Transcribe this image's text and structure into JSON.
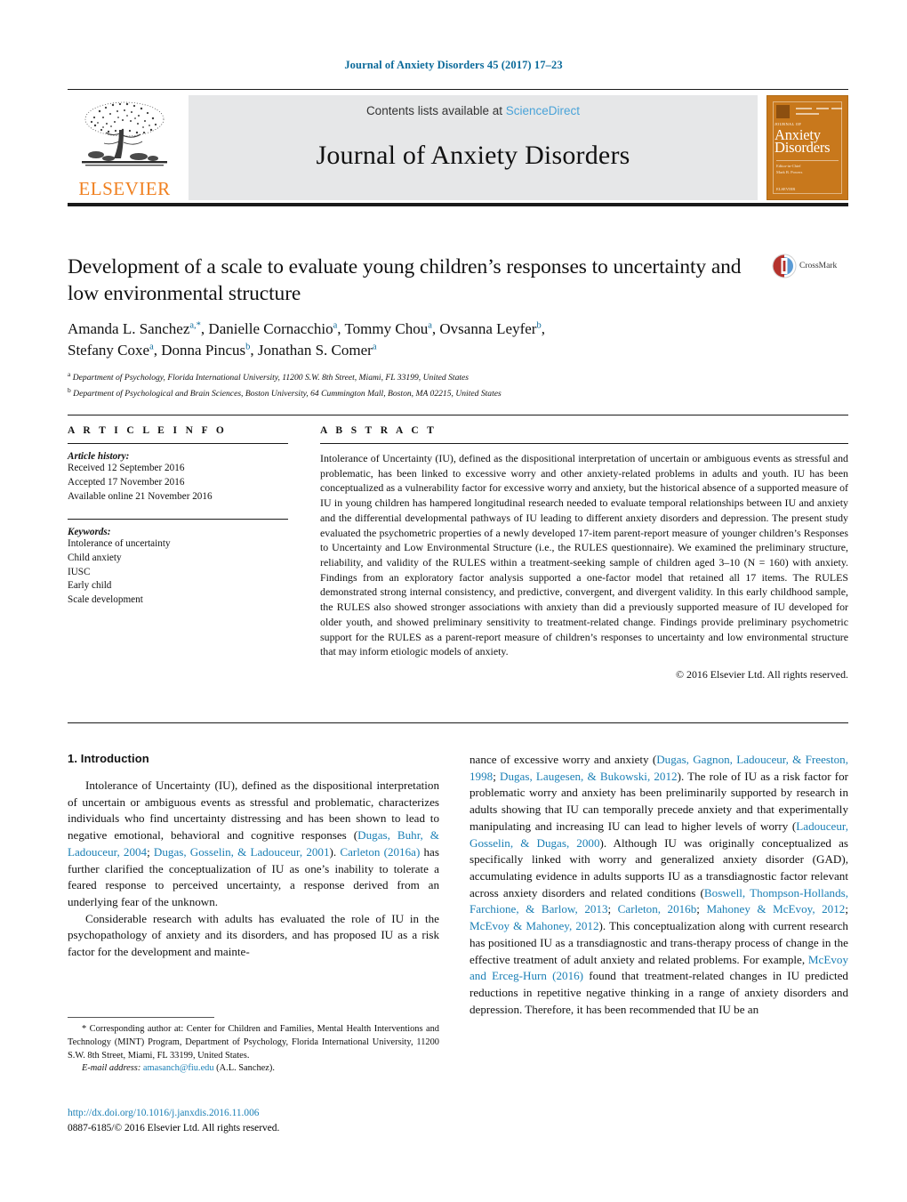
{
  "running_head": "Journal of Anxiety Disorders 45 (2017) 17–23",
  "masthead": {
    "contents_prefix": "Contents lists available at ",
    "sciencedirect": "ScienceDirect",
    "journal_name": "Journal of Anxiety Disorders",
    "publisher": "ELSEVIER",
    "cover": {
      "small_top": "JOURNAL OF",
      "line1": "Anxiety",
      "line2": "Disorders",
      "editor_line1": "Editor-in-Chief",
      "editor_line2": "Mark B. Powers",
      "footer": "ELSEVIER"
    }
  },
  "article": {
    "title": "Development of a scale to evaluate young children’s responses to uncertainty and low environmental structure",
    "crossmark_label": "CrossMark",
    "authors_line1_a": "Amanda L. Sanchez",
    "authors_line1_a_sup": "a,*",
    "authors_line1_b": ", Danielle Cornacchio",
    "authors_line1_b_sup": "a",
    "authors_line1_c": ", Tommy Chou",
    "authors_line1_c_sup": "a",
    "authors_line1_d": ", Ovsanna Leyfer",
    "authors_line1_d_sup": "b",
    "authors_line1_end": ",",
    "authors_line2_a": "Stefany Coxe",
    "authors_line2_a_sup": "a",
    "authors_line2_b": ", Donna Pincus",
    "authors_line2_b_sup": "b",
    "authors_line2_c": ", Jonathan S. Comer",
    "authors_line2_c_sup": "a",
    "affiliation_a_sup": "a",
    "affiliation_a": "Department of Psychology, Florida International University, 11200 S.W. 8th Street, Miami, FL 33199, United States",
    "affiliation_b_sup": "b",
    "affiliation_b": "Department of Psychological and Brain Sciences, Boston University, 64 Cummington Mall, Boston, MA 02215, United States"
  },
  "article_info": {
    "heading": "A R T I C L E   I N F O",
    "history_label": "Article history:",
    "received": "Received 12 September 2016",
    "accepted": "Accepted 17 November 2016",
    "available": "Available online 21 November 2016",
    "keywords_label": "Keywords:",
    "keywords": [
      "Intolerance of uncertainty",
      "Child anxiety",
      "IUSC",
      "Early child",
      "Scale development"
    ]
  },
  "abstract": {
    "heading": "A B S T R A C T",
    "text": "Intolerance of Uncertainty (IU), defined as the dispositional interpretation of uncertain or ambiguous events as stressful and problematic, has been linked to excessive worry and other anxiety-related problems in adults and youth. IU has been conceptualized as a vulnerability factor for excessive worry and anxiety, but the historical absence of a supported measure of IU in young children has hampered longitudinal research needed to evaluate temporal relationships between IU and anxiety and the differential developmental pathways of IU leading to different anxiety disorders and depression. The present study evaluated the psychometric properties of a newly developed 17-item parent-report measure of younger children’s Responses to Uncertainty and Low Environmental Structure (i.e., the RULES questionnaire). We examined the preliminary structure, reliability, and validity of the RULES within a treatment-seeking sample of children aged 3–10 (N = 160) with anxiety. Findings from an exploratory factor analysis supported a one-factor model that retained all 17 items. The RULES demonstrated strong internal consistency, and predictive, convergent, and divergent validity. In this early childhood sample, the RULES also showed stronger associations with anxiety than did a previously supported measure of IU developed for older youth, and showed preliminary sensitivity to treatment-related change. Findings provide preliminary psychometric support for the RULES as a parent-report measure of children’s responses to uncertainty and low environmental structure that may inform etiologic models of anxiety.",
    "copyright": "© 2016 Elsevier Ltd. All rights reserved."
  },
  "body": {
    "section_title": "1. Introduction",
    "left_p1_part1": "Intolerance of Uncertainty (IU), defined as the dispositional interpretation of uncertain or ambiguous events as stressful and problematic, characterizes individuals who find uncertainty distressing and has been shown to lead to negative emotional, behavioral and cognitive responses (",
    "left_p1_ref1": "Dugas, Buhr, & Ladouceur, 2004",
    "left_p1_sep1": "; ",
    "left_p1_ref2": "Dugas, Gosselin, & Ladouceur, 2001",
    "left_p1_part2": "). ",
    "left_p1_ref3": "Carleton (2016a)",
    "left_p1_part3": " has further clarified the conceptualization of IU as one’s inability to tolerate a feared response to perceived uncertainty, a response derived from an underlying fear of the unknown.",
    "left_p2": "Considerable research with adults has evaluated the role of IU in the psychopathology of anxiety and its disorders, and has proposed IU as a risk factor for the development and mainte-",
    "right_p1_part1": "nance of excessive worry and anxiety (",
    "right_p1_ref1": "Dugas, Gagnon, Ladouceur, & Freeston, 1998",
    "right_p1_sep1": "; ",
    "right_p1_ref2": "Dugas, Laugesen, & Bukowski, 2012",
    "right_p1_part2": "). The role of IU as a risk factor for problematic worry and anxiety has been preliminarily supported by research in adults showing that IU can temporally precede anxiety and that experimentally manipulating and increasing IU can lead to higher levels of worry (",
    "right_p1_ref3": "Ladouceur, Gosselin, & Dugas, 2000",
    "right_p1_part3": "). Although IU was originally conceptualized as specifically linked with worry and generalized anxiety disorder (GAD), accumulating evidence in adults supports IU as a transdiagnostic factor relevant across anxiety disorders and related conditions (",
    "right_p1_ref4": "Boswell, Thompson-Hollands, Farchione, & Barlow, 2013",
    "right_p1_sep2": "; ",
    "right_p1_ref5": "Carleton, 2016b",
    "right_p1_sep3": "; ",
    "right_p1_ref6": "Mahoney & McEvoy, 2012",
    "right_p1_sep4": "; ",
    "right_p1_ref7": "McEvoy & Mahoney, 2012",
    "right_p1_part4": "). This conceptualization along with current research has positioned IU as a transdiagnostic and trans-therapy process of change in the effective treatment of adult anxiety and related problems. For example, ",
    "right_p1_ref8": "McEvoy and Erceg-Hurn (2016)",
    "right_p1_part5": " found that treatment-related changes in IU predicted reductions in repetitive negative thinking in a range of anxiety disorders and depression. Therefore, it has been recommended that IU be an"
  },
  "footer": {
    "star": "*",
    "corresponding": " Corresponding author at: Center for Children and Families, Mental Health Interventions and Technology (MINT) Program, Department of Psychology, Florida International University, 11200 S.W. 8th Street, Miami, FL 33199, United States.",
    "email_label": "E-mail address:",
    "email": "amasanch@fiu.edu",
    "email_suffix": " (A.L. Sanchez).",
    "doi": "http://dx.doi.org/10.1016/j.janxdis.2016.11.006",
    "issn_line": "0887-6185/© 2016 Elsevier Ltd. All rights reserved."
  },
  "colors": {
    "link_blue": "#1a7fb5",
    "running_head_blue": "#0b6a9a",
    "sciencedirect_blue": "#4aa3d8",
    "elsevier_orange": "#f08020",
    "cover_orange": "#c8781c"
  }
}
